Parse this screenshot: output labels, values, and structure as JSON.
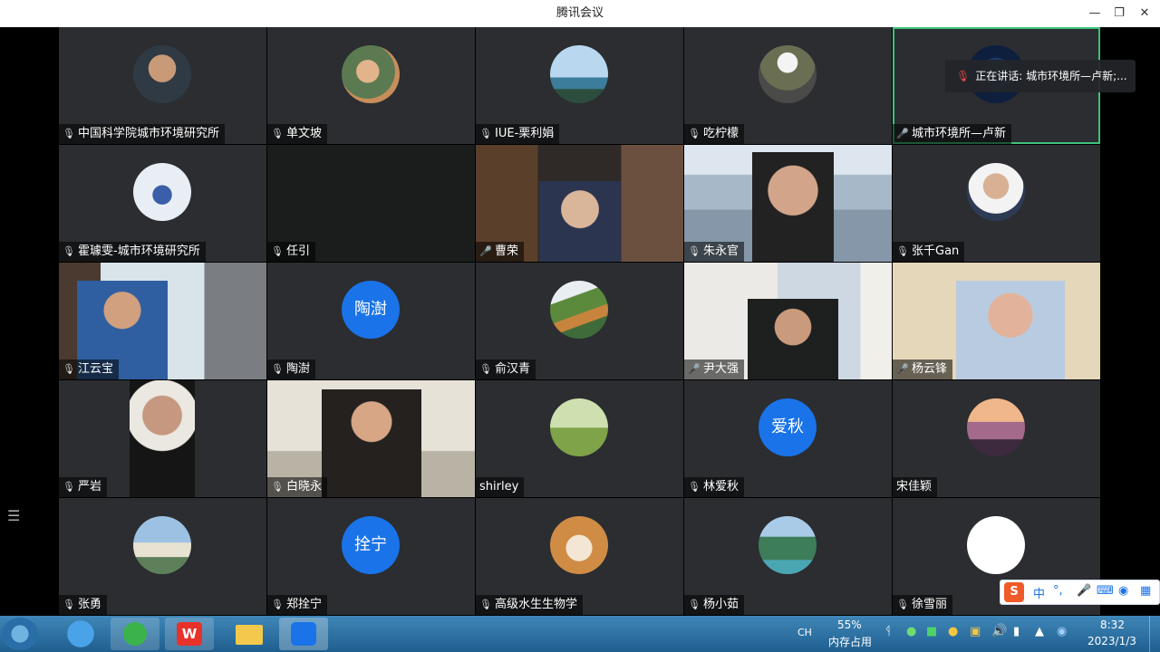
{
  "window": {
    "title": "腾讯会议"
  },
  "speaking_tooltip": "正在讲话: 城市环境所—卢新;...",
  "tiles": [
    {
      "name": "中国科学院城市环境研究所",
      "mic": "muted"
    },
    {
      "name": "单文坡",
      "mic": "muted"
    },
    {
      "name": "IUE-栗利娟",
      "mic": "muted"
    },
    {
      "name": "吃柠檬",
      "mic": "muted"
    },
    {
      "name": "城市环境所—卢新",
      "mic": "on"
    },
    {
      "name": "霍璩雯-城市环境研究所",
      "mic": "muted"
    },
    {
      "name": "任引",
      "mic": "muted"
    },
    {
      "name": "曹荣",
      "mic": "on"
    },
    {
      "name": "朱永官",
      "mic": "muted"
    },
    {
      "name": "张千Gan",
      "mic": "muted"
    },
    {
      "name": "江云宝",
      "mic": "muted"
    },
    {
      "name": "陶澍",
      "mic": "muted",
      "initials": "陶澍"
    },
    {
      "name": "俞汉青",
      "mic": "muted"
    },
    {
      "name": "尹大强",
      "mic": "on"
    },
    {
      "name": "杨云锋",
      "mic": "on"
    },
    {
      "name": "严岩",
      "mic": "muted"
    },
    {
      "name": "白晓永",
      "mic": "muted"
    },
    {
      "name": "shirley",
      "mic": "none"
    },
    {
      "name": "林爱秋",
      "mic": "muted",
      "initials": "爱秋"
    },
    {
      "name": "宋佳颖",
      "mic": "none"
    },
    {
      "name": "张勇",
      "mic": "muted"
    },
    {
      "name": "郑拴宁",
      "mic": "muted",
      "initials": "拴宁"
    },
    {
      "name": "高级水生生物学",
      "mic": "muted"
    },
    {
      "name": "杨小茹",
      "mic": "muted"
    },
    {
      "name": "徐雪丽",
      "mic": "muted"
    }
  ],
  "ime": {
    "lang": "中",
    "punct": "°,"
  },
  "taskbar": {
    "lang": "CH",
    "memory_percent": "55%",
    "memory_label": "内存占用",
    "time": "8:32",
    "date": "2023/1/3"
  }
}
